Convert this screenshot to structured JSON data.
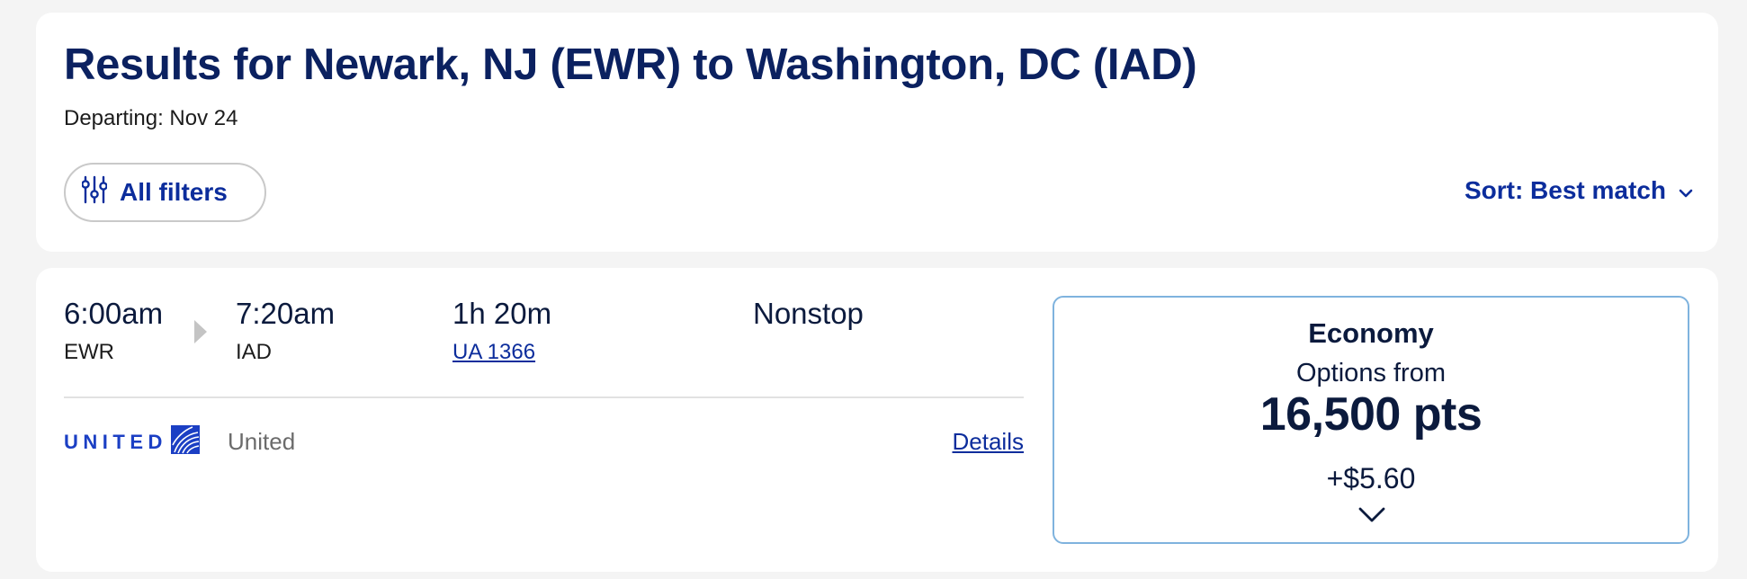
{
  "header": {
    "title": "Results for Newark, NJ (EWR) to Washington, DC (IAD)",
    "departing": "Departing: Nov 24",
    "filters_label": "All filters",
    "sort_label": "Sort: Best match"
  },
  "result": {
    "depart_time": "6:00am",
    "depart_code": "EWR",
    "arrive_time": "7:20am",
    "arrive_code": "IAD",
    "duration": "1h 20m",
    "flight_number": "UA 1366",
    "stops": "Nonstop",
    "airline_logo_text": "UNITED",
    "airline_name": "United",
    "details_label": "Details",
    "fare": {
      "cabin": "Economy",
      "options_label": "Options from",
      "points": "16,500 pts",
      "fee": "+$5.60"
    }
  },
  "colors": {
    "title": "#0b2160",
    "link": "#0c2d9c",
    "fare_border": "#7fb3de",
    "united_blue": "#1b3fc4"
  },
  "icons": [
    "sliders-icon",
    "chevron-down-icon",
    "arrow-right-icon",
    "united-globe-icon",
    "chevron-down-icon"
  ]
}
